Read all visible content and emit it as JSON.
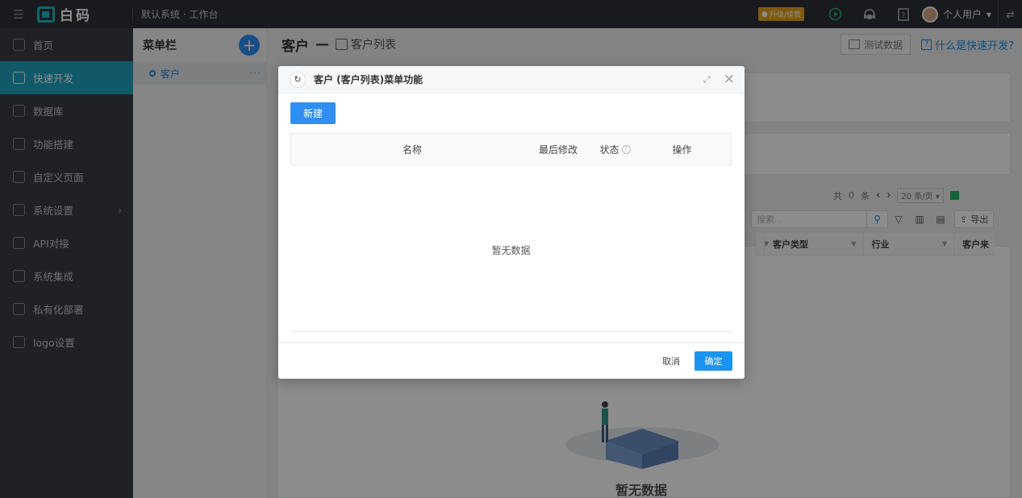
{
  "topbar": {
    "app_name": "白码",
    "breadcrumb": "默认系统 · 工作台",
    "upgrade_label": "升级/续费",
    "user_name": "个人用户"
  },
  "sidebar": {
    "items": [
      {
        "label": "首页",
        "icon": "home-icon"
      },
      {
        "label": "快速开发",
        "icon": "cube-icon"
      },
      {
        "label": "数据库",
        "icon": "database-icon"
      },
      {
        "label": "功能搭建",
        "icon": "build-icon"
      },
      {
        "label": "自定义页面",
        "icon": "page-icon"
      },
      {
        "label": "系统设置",
        "icon": "settings-icon"
      },
      {
        "label": "API对接",
        "icon": "api-icon"
      },
      {
        "label": "系统集成",
        "icon": "integration-icon"
      },
      {
        "label": "私有化部署",
        "icon": "deploy-icon"
      },
      {
        "label": "logo设置",
        "icon": "logo-icon"
      }
    ],
    "active_index": 1
  },
  "menu_column": {
    "title": "菜单栏",
    "entries": [
      {
        "label": "客户"
      }
    ]
  },
  "main": {
    "title": "客户",
    "dash": "—",
    "subtitle": "客户列表",
    "test_data_label": "测试数据",
    "help_label": "什么是快速开发?",
    "pager": {
      "total_prefix": "共",
      "total_count": "0",
      "total_suffix": "条",
      "page_size": "20 条/页"
    },
    "search_placeholder": "搜索...",
    "export_label": "导出",
    "columns": [
      "客户类型",
      "行业",
      "客户来"
    ],
    "empty_text": "暂无数据"
  },
  "modal": {
    "title": "客户 (客户列表)菜单功能",
    "new_button": "新建",
    "columns": {
      "name": "名称",
      "last_modified": "最后修改",
      "status": "状态",
      "action": "操作"
    },
    "empty_text": "暂无数据",
    "cancel_label": "取消",
    "confirm_label": "确定"
  },
  "colors": {
    "topbar_bg": "#2f3136",
    "sidebar_bg": "#3a3d43",
    "active_item": "#1fa3c0",
    "primary": "#2f8ff3",
    "upgrade_badge": "#e6a21a"
  }
}
